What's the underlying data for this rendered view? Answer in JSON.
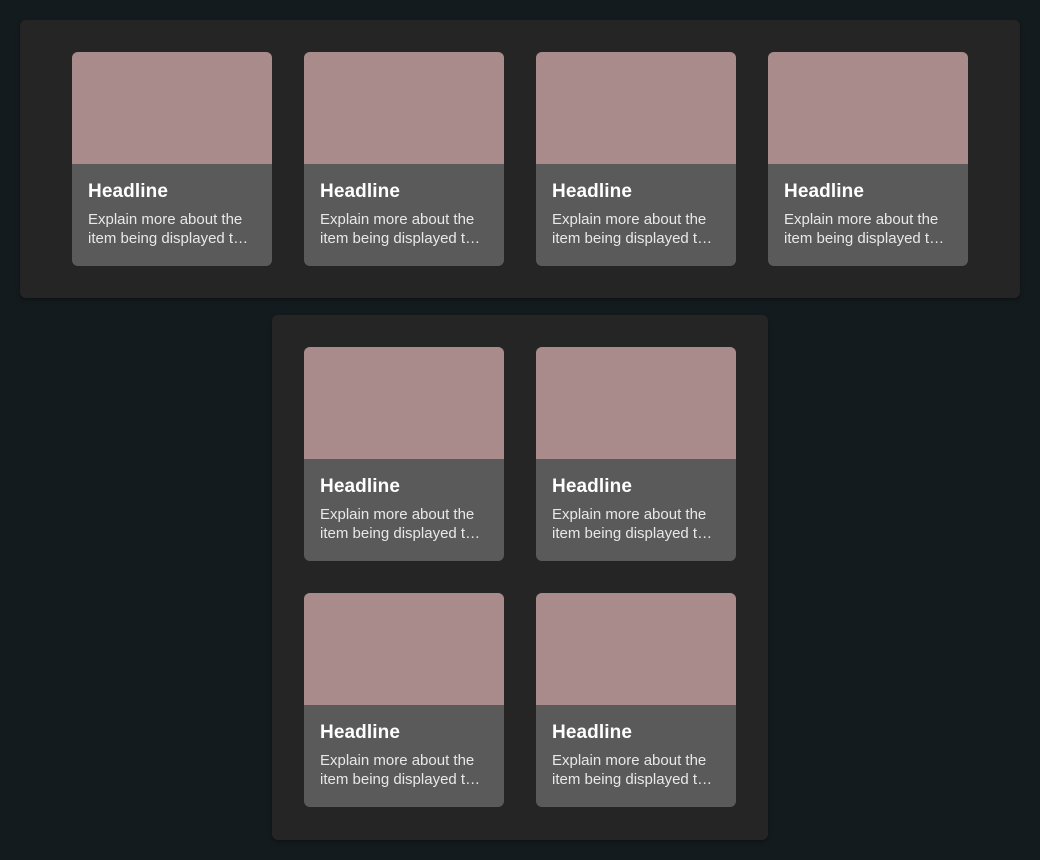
{
  "top_row": {
    "cards": [
      {
        "headline": "Headline",
        "description": "Explain more about the item being displayed to the user here"
      },
      {
        "headline": "Headline",
        "description": "Explain more about the item being displayed to the user here"
      },
      {
        "headline": "Headline",
        "description": "Explain more about the item being displayed to the user here"
      },
      {
        "headline": "Headline",
        "description": "Explain more about the item being displayed to the user here"
      }
    ]
  },
  "grid": {
    "cards": [
      {
        "headline": "Headline",
        "description": "Explain more about the item being displayed to the user here"
      },
      {
        "headline": "Headline",
        "description": "Explain more about the item being displayed to the user here"
      },
      {
        "headline": "Headline",
        "description": "Explain more about the item being displayed to the user here"
      },
      {
        "headline": "Headline",
        "description": "Explain more about the item being displayed to the user here"
      }
    ]
  },
  "colors": {
    "page_background": "#141b1e",
    "panel_background": "#252525",
    "card_background": "#5a5a5a",
    "media_placeholder": "#a98b8c"
  }
}
